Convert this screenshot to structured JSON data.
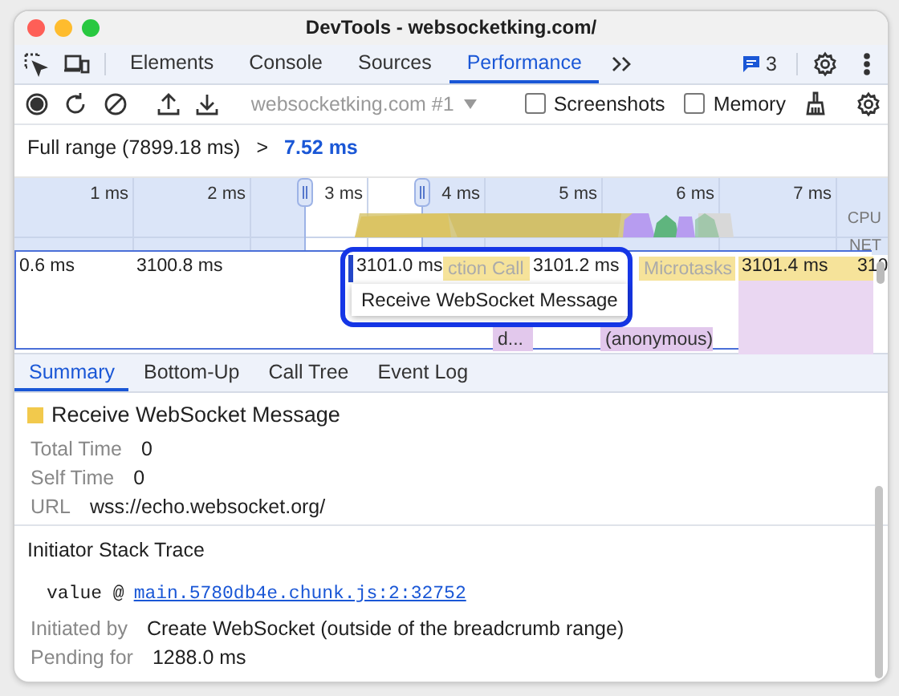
{
  "window": {
    "title": "DevTools - websocketking.com/"
  },
  "tabs": [
    {
      "label": "Elements",
      "selected": false
    },
    {
      "label": "Console",
      "selected": false
    },
    {
      "label": "Sources",
      "selected": false
    },
    {
      "label": "Performance",
      "selected": true
    }
  ],
  "issues_count": "3",
  "toolbar": {
    "target": "websocketking.com #1",
    "checkboxes": [
      {
        "label": "Screenshots",
        "checked": false
      },
      {
        "label": "Memory",
        "checked": false
      }
    ]
  },
  "breadcrumb": {
    "full_range": "Full range (7899.18 ms)",
    "separator": ">",
    "current": "7.52 ms"
  },
  "overview": {
    "ticks": [
      "1 ms",
      "2 ms",
      "3 ms",
      "4 ms",
      "5 ms",
      "6 ms",
      "7 ms"
    ],
    "tracks": [
      "CPU",
      "NET"
    ]
  },
  "flame": {
    "time_labels": [
      "0.6 ms",
      "3100.8 ms",
      "3101.0 ms",
      "3101.2 ms",
      "3101.4 ms",
      "310"
    ],
    "events": [
      {
        "label": "ction Call",
        "color": "#f6e39a"
      },
      {
        "label": "Microtasks",
        "color": "#f6e39a"
      },
      {
        "label": "d...",
        "color": "#e2c8ec"
      },
      {
        "label": "(anonymous)",
        "color": "#e2c8ec"
      }
    ],
    "tooltip": "Receive WebSocket Message"
  },
  "detail_tabs": [
    {
      "label": "Summary",
      "selected": true
    },
    {
      "label": "Bottom-Up",
      "selected": false
    },
    {
      "label": "Call Tree",
      "selected": false
    },
    {
      "label": "Event Log",
      "selected": false
    }
  ],
  "summary": {
    "title": "Receive WebSocket Message",
    "color": "#f2c94c",
    "rows": [
      {
        "label": "Total Time",
        "value": "0"
      },
      {
        "label": "Self Time",
        "value": "0"
      },
      {
        "label": "URL",
        "value": "wss://echo.websocket.org/"
      }
    ]
  },
  "initiator": {
    "heading": "Initiator Stack Trace",
    "frame": "value @",
    "link": "main.5780db4e.chunk.js:2:32752",
    "rows": [
      {
        "label": "Initiated by",
        "value": "Create WebSocket (outside of the breadcrumb range)"
      },
      {
        "label": "Pending for",
        "value": "1288.0 ms"
      }
    ]
  }
}
